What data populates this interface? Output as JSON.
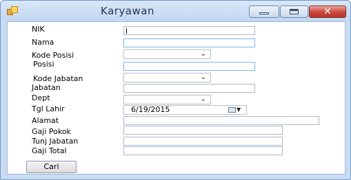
{
  "window": {
    "title": "Karyawan",
    "icon": "form-icon",
    "controls": {
      "minimize": "minimize-icon",
      "maximize": "maximize-icon",
      "close_glyph": "✕"
    }
  },
  "form": {
    "labels": {
      "nik": "NIK",
      "nama": "Nama",
      "kode_posisi": "Kode Posisi",
      "posisi": "Posisi",
      "kode_jabatan": "Kode Jabatan",
      "jabatan": "Jabatan",
      "dept": "Dept",
      "tgl_lahir": "Tgl Lahir",
      "alamat": "Alamat",
      "gaji_pokok": "Gaji Pokok",
      "tunj_jabatan": "Tunj Jabatan",
      "gaji_total": "Gaji Total"
    },
    "values": {
      "nik": "",
      "nama": "",
      "kode_posisi": "",
      "posisi": "",
      "kode_jabatan": "",
      "jabatan": "",
      "dept": "",
      "tgl_lahir": "6/19/2015",
      "alamat": "",
      "gaji_pokok": "",
      "tunj_jabatan": "",
      "gaji_total": ""
    },
    "dropdown_arrow": "⌄",
    "date_dropdown_arrow": "▼",
    "cari_label": "Cari"
  }
}
